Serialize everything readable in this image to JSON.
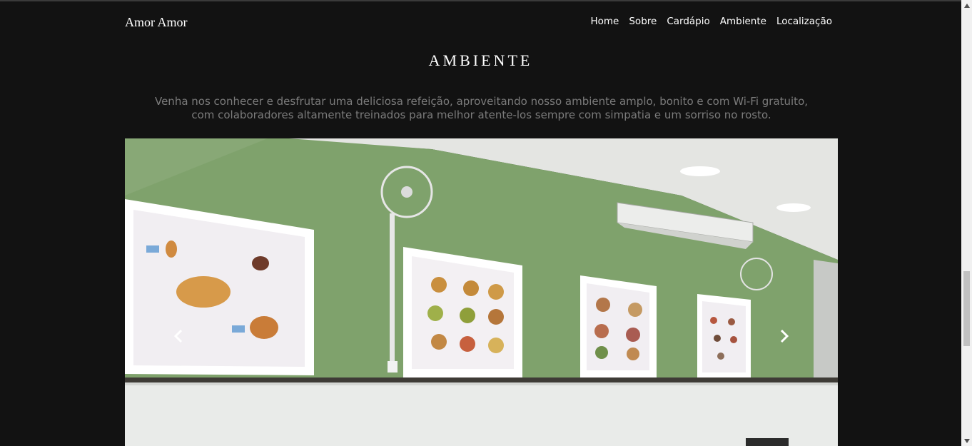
{
  "navbar": {
    "brand": "Amor Amor",
    "links": [
      "Home",
      "Sobre",
      "Cardápio",
      "Ambiente",
      "Localização"
    ]
  },
  "section": {
    "title": "AMBIENTE",
    "lead_line1": "Venha nos conhecer e desfrutar uma deliciosa refeição, aproveitando nosso ambiente amplo, bonito e com Wi-Fi gratuito,",
    "lead_line2": "com colaboradores altamente treinados para melhor atente-los sempre com simpatia e um sorriso no rosto."
  },
  "carousel": {
    "prev_icon": "chevron-left-icon",
    "next_icon": "chevron-right-icon"
  },
  "colors": {
    "background": "#121212",
    "wall": "#7fa26c",
    "text_muted": "#7b7b7b"
  }
}
